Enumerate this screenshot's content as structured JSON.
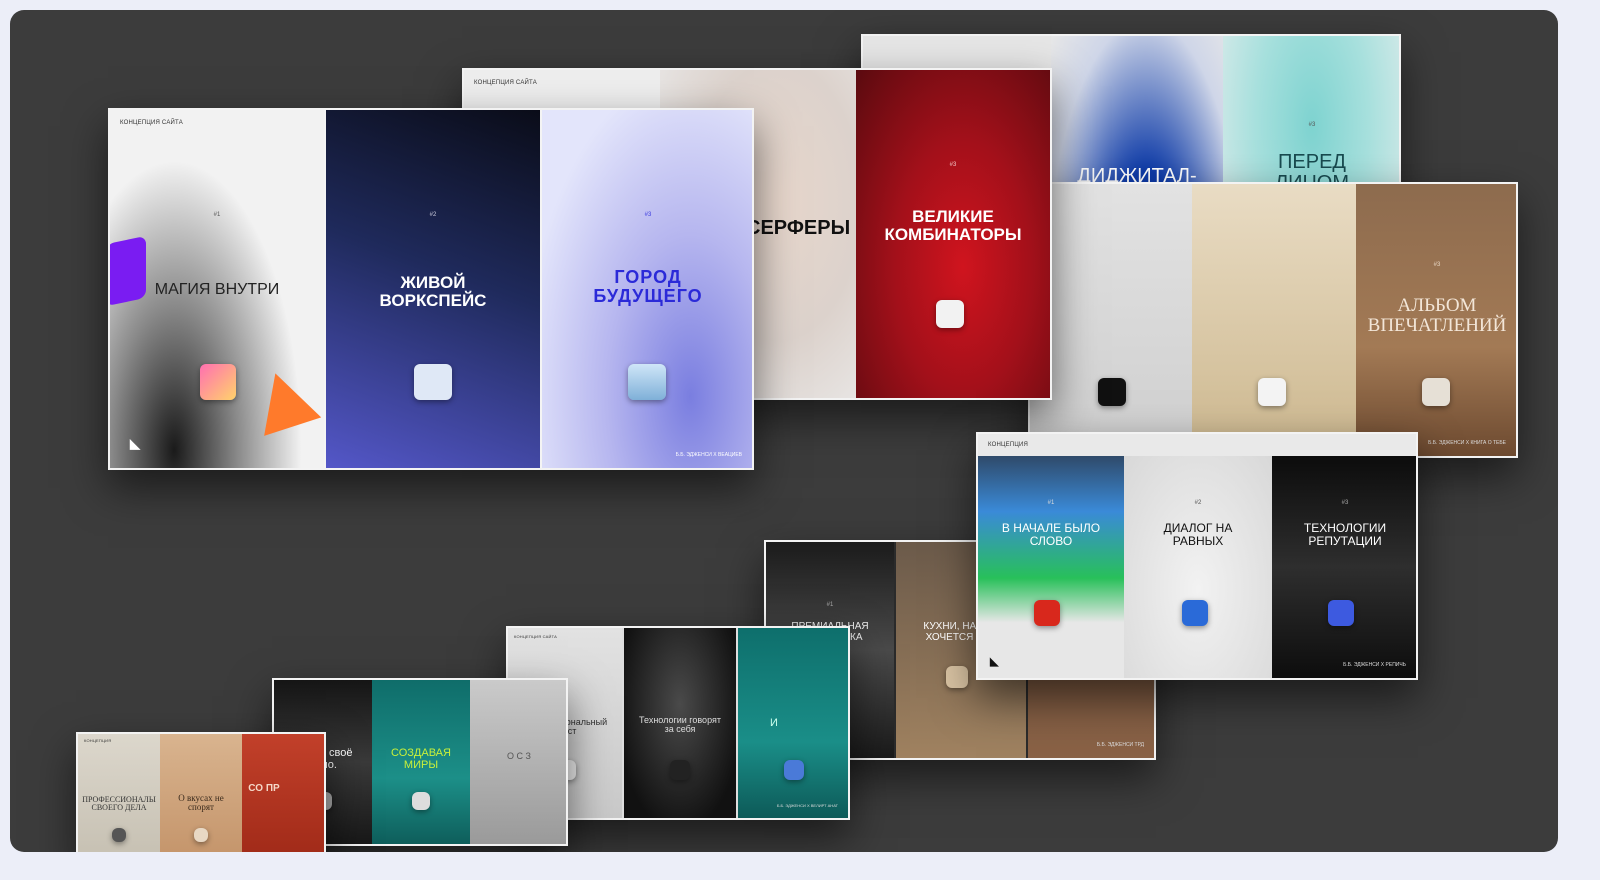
{
  "concept_label": "КОНЦЕПЦИЯ САЙТА",
  "concept_short": "КОНЦЕПЦИЯ",
  "logo_glyph": "◣",
  "footer_text": "Б.Б. ЭДЖЕНСИ Х ВЕАЦИЕВ",
  "board1": {
    "panels": [
      {
        "num": "#1",
        "title": "МАГИЯ ВНУТРИ"
      },
      {
        "num": "#2",
        "title": "ЖИВОЙ ВОРКСПЕЙС"
      },
      {
        "num": "#3",
        "title": "ГОРОД БУДУЩЕГО"
      }
    ]
  },
  "board2": {
    "panels": [
      {
        "num": "#2",
        "title": "СЕРФЕРЫ"
      },
      {
        "num": "#3",
        "title": "ВЕЛИКИЕ КОМБИНАТОРЫ"
      }
    ]
  },
  "board3": {
    "panels": [
      {
        "num": "#2",
        "title": "ДИДЖИТАЛ- ЭРА"
      },
      {
        "num": "#3",
        "title": "ПЕРЕД ЛИЦОМ ФАКТОВ"
      }
    ]
  },
  "board4": {
    "panels": [
      {
        "num": "#3",
        "title": "АЛЬБОМ ВПЕЧАТЛЕНИЙ"
      }
    ],
    "footer": "Б.Б. ЭДЖЕНСИ Х КНИГА О ТЕБЕ"
  },
  "board5": {
    "panels": [
      {
        "num": "#1",
        "title": "В НАЧАЛЕ БЫЛО СЛОВО"
      },
      {
        "num": "#2",
        "title": "ДИАЛОГ НА РАВНЫХ"
      },
      {
        "num": "#3",
        "title": "ТЕХНОЛОГИИ РЕПУТАЦИИ"
      }
    ],
    "footer": "Б.Б. ЭДЖЕНСИ Х РЕПИЧЬ"
  },
  "board6": {
    "panels": [
      {
        "num": "#1",
        "title": "ПРЕМИАЛЬНАЯ ПРАГМАТИКА"
      },
      {
        "num": "#2",
        "title": "КУХНИ, НА КОТ ХОЧЕТСЯ ТВО"
      }
    ],
    "footer": "Б.Б. ЭДЖЕНСИ ТРД"
  },
  "board7": {
    "panels": [
      {
        "num": "",
        "title": "Профессиональный траст"
      },
      {
        "num": "",
        "title": "Технологии говорят за себя"
      },
      {
        "num": "",
        "title": "И"
      }
    ],
    "footer": "Б.Б. ЭДЖЕНСИ Х ВЕЛИРТ АНАТ"
  },
  "board8": {
    "panels": [
      {
        "num": "",
        "title": "Знаем своё дело."
      },
      {
        "num": "",
        "title": "СОЗДАВАЯ МИРЫ"
      },
      {
        "num": "",
        "title": "О С З"
      }
    ]
  },
  "board9": {
    "panels": [
      {
        "num": "",
        "title": "ПРОФЕССИОНАЛЫ СВОЕГО ДЕЛА"
      },
      {
        "num": "",
        "title": "О вкусах не спорят"
      },
      {
        "num": "",
        "title": "СО ПР"
      }
    ]
  },
  "colors": {
    "canvas": "#3c3c3c",
    "page": "#eceef8",
    "accent_blue": "#2b2ad8",
    "accent_red": "#b0121b"
  }
}
